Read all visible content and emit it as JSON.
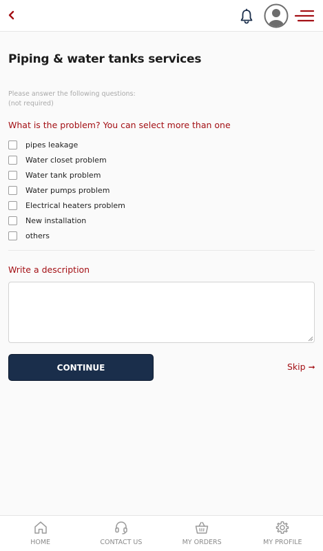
{
  "header": {
    "back_icon": "chevron-left-icon",
    "notification_icon": "bell-icon",
    "avatar_icon": "user-avatar-icon",
    "menu_icon": "hamburger-menu-icon",
    "accent_color": "#a30f14"
  },
  "page": {
    "title": "Piping & water tanks services",
    "hint_line1": "Please answer the following questions:",
    "hint_line2": "(not required)"
  },
  "question": {
    "label": "What is the problem? You can select more than one",
    "options": [
      {
        "label": "pipes leakage",
        "checked": false
      },
      {
        "label": "Water closet problem",
        "checked": false
      },
      {
        "label": "Water tank problem",
        "checked": false
      },
      {
        "label": "Water pumps problem",
        "checked": false
      },
      {
        "label": "Electrical heaters problem",
        "checked": false
      },
      {
        "label": "New installation",
        "checked": false
      },
      {
        "label": "others",
        "checked": false
      }
    ]
  },
  "description": {
    "label": "Write a description",
    "value": ""
  },
  "actions": {
    "continue_label": "CONTINUE",
    "continue_color": "#1a2e4b",
    "skip_label": "Skip",
    "skip_icon": "arrow-right-icon"
  },
  "bottom_nav": [
    {
      "label": "HOME",
      "icon": "home-icon"
    },
    {
      "label": "CONTACT US",
      "icon": "headset-icon"
    },
    {
      "label": "MY ORDERS",
      "icon": "basket-icon"
    },
    {
      "label": "MY PROFILE",
      "icon": "gear-icon"
    }
  ]
}
